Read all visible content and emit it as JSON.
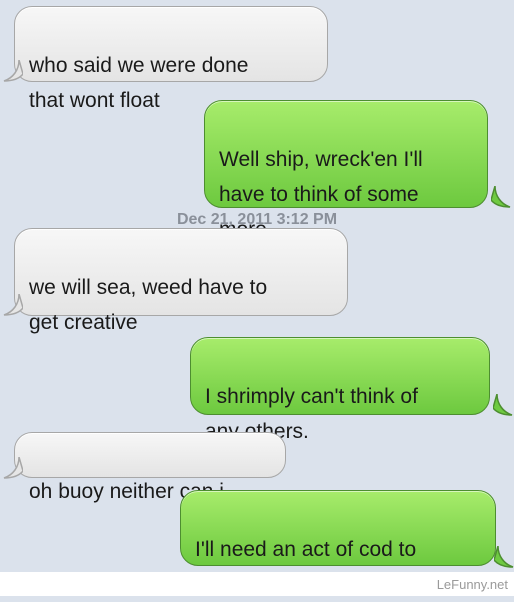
{
  "messages": [
    {
      "direction": "incoming",
      "text": "who said we were done\nthat wont float"
    },
    {
      "direction": "outgoing",
      "text": "Well ship, wreck'en I'll\nhave to think of some\nmore."
    },
    {
      "direction": "incoming",
      "text": "we will sea, weed have to\nget creative"
    },
    {
      "direction": "outgoing",
      "text": "I shrimply can't think of\nany others."
    },
    {
      "direction": "incoming",
      "text": "oh buoy neither can i"
    },
    {
      "direction": "outgoing",
      "text": "I'll need an act of cod to\nthink of some more."
    }
  ],
  "timestamp": "Dec 21, 2011 3:12 PM",
  "watermark": "LeFunny.net",
  "colors": {
    "background": "#dbe2ec",
    "incoming_bubble": "#ececec",
    "outgoing_bubble": "#8cdc55",
    "timestamp": "#8a909a"
  }
}
